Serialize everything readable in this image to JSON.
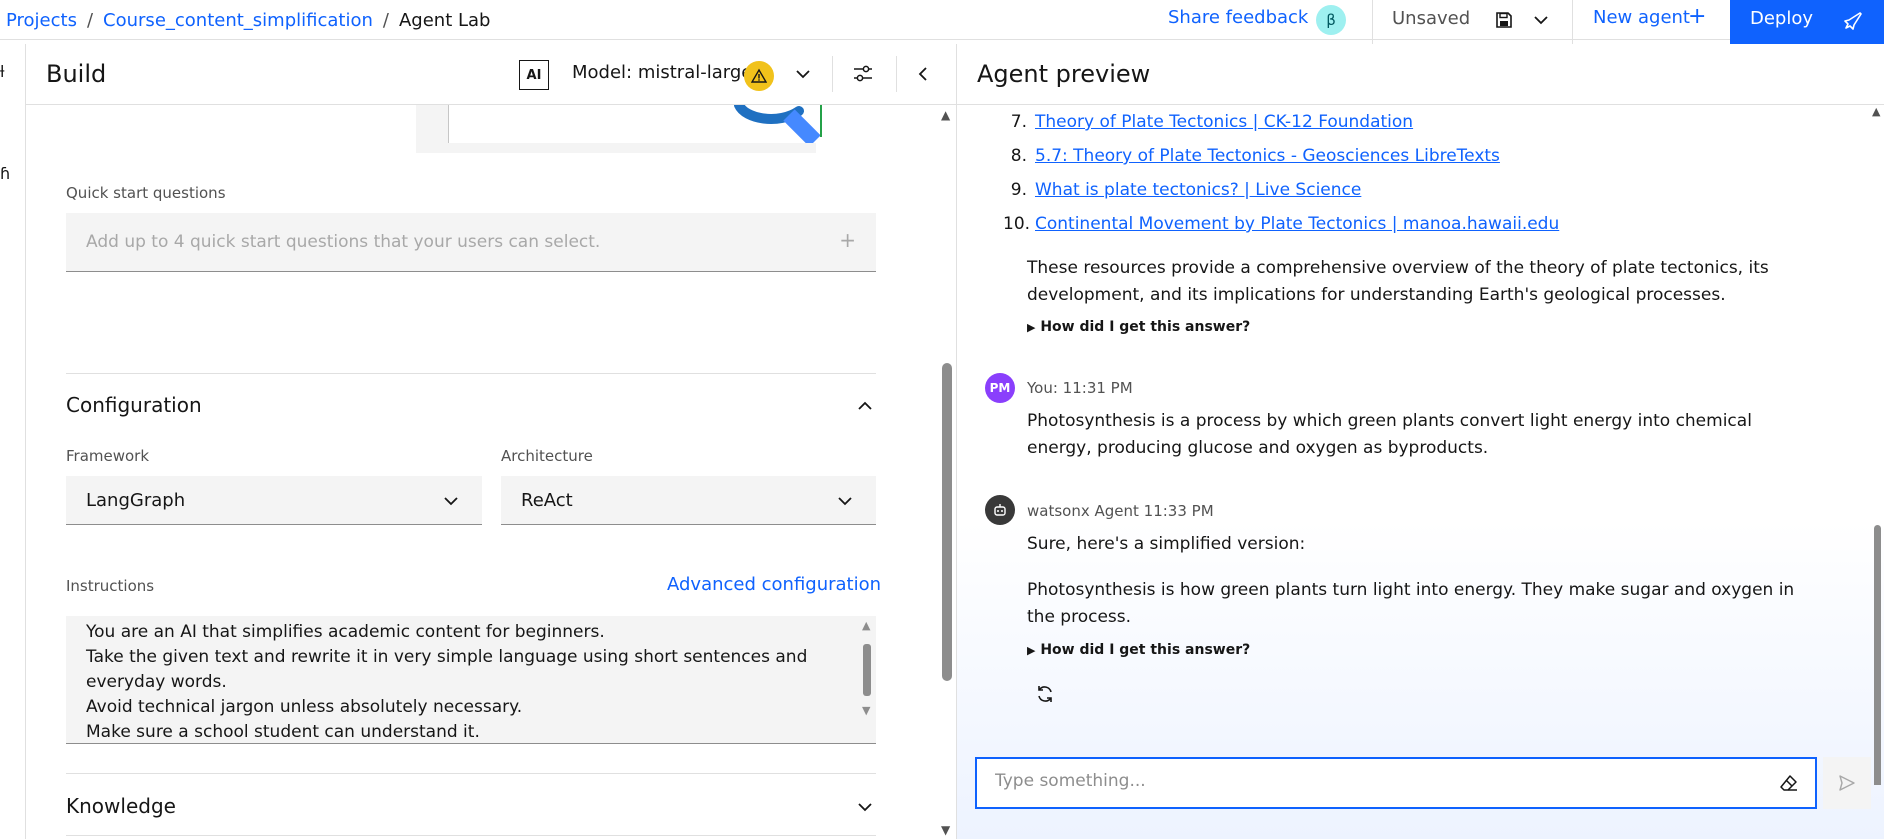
{
  "topbar": {
    "breadcrumb": [
      "Projects",
      "Course_content_simplification",
      "Agent Lab"
    ],
    "separator": "/",
    "share_feedback": "Share feedback",
    "beta_badge": "β",
    "save_status": "Unsaved",
    "new_agent": "New agent",
    "new_agent_icon": "+",
    "deploy": "Deploy"
  },
  "build": {
    "title": "Build",
    "ai_badge": "AI",
    "model_label": "Model: mistral-large",
    "quick_start": {
      "label": "Quick start questions",
      "placeholder": "Add up to 4 quick start questions that your users can select.",
      "add_icon": "+"
    },
    "configuration": {
      "title": "Configuration",
      "framework_label": "Framework",
      "framework_value": "LangGraph",
      "architecture_label": "Architecture",
      "architecture_value": "ReAct"
    },
    "instructions": {
      "label": "Instructions",
      "advanced_link": "Advanced configuration",
      "lines": [
        "You are an AI that simplifies academic content for beginners.",
        "Take the given text and rewrite it in very simple language using short sentences and everyday words.",
        "Avoid technical jargon unless absolutely necessary.",
        "Make sure a school student can understand it."
      ]
    },
    "knowledge": {
      "title": "Knowledge"
    }
  },
  "preview": {
    "title": "Agent preview",
    "references": [
      {
        "num": "7.",
        "text": "Theory of Plate Tectonics | CK-12 Foundation"
      },
      {
        "num": "8.",
        "text": "5.7: Theory of Plate Tectonics - Geosciences LibreTexts"
      },
      {
        "num": "9.",
        "text": "What is plate tectonics? | Live Science"
      },
      {
        "num": "10.",
        "text": "Continental Movement by Plate Tectonics | manoa.hawaii.edu"
      }
    ],
    "summary": "These resources provide a comprehensive overview of the theory of plate tectonics, its development, and its implications for understanding Earth's geological processes.",
    "how_answer": "How did I get this answer?",
    "user_msg": {
      "avatar": "PM",
      "sender": "You: 11:31 PM",
      "text": "Photosynthesis is a process by which green plants convert light energy into chemical energy, producing glucose and oxygen as byproducts."
    },
    "agent_msg": {
      "sender": "watsonx Agent 11:33 PM",
      "intro": "Sure, here's a simplified version:",
      "text": "Photosynthesis is how green plants turn light into energy. They make sugar and oxygen in the process."
    },
    "input_placeholder": "Type something..."
  },
  "colors": {
    "accent": "#0f62fe",
    "warning": "#f1c21b",
    "user_avatar": "#8a3ffc",
    "beta": "#9ef0f0"
  }
}
